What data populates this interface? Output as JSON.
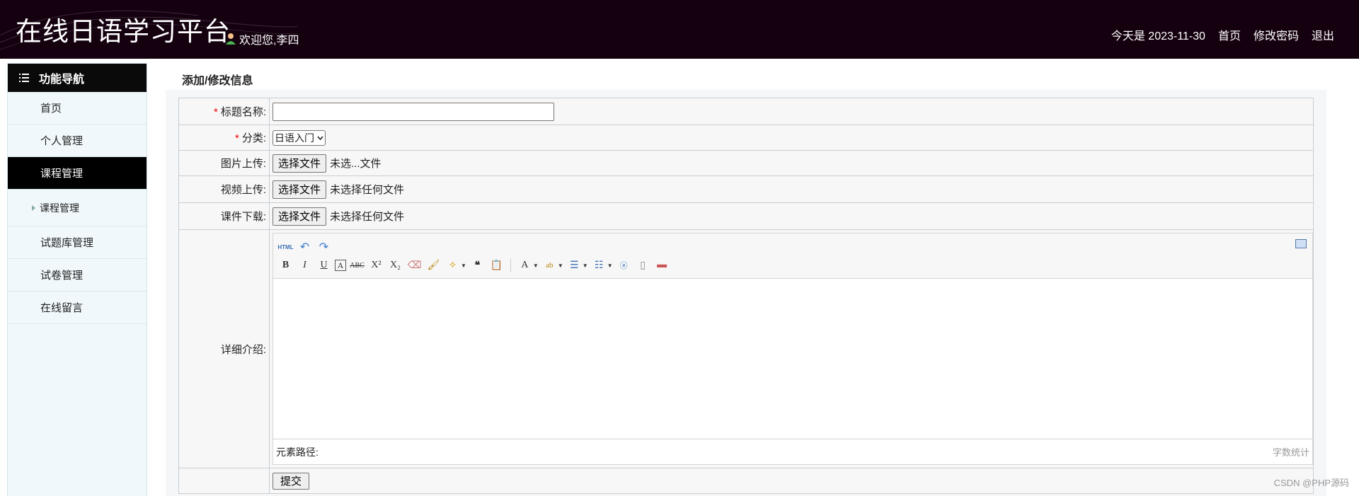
{
  "header": {
    "site_title": "在线日语学习平台",
    "welcome": "欢迎您,李四",
    "date_text": "今天是 2023-11-30",
    "links": [
      "首页",
      "修改密码",
      "退出"
    ]
  },
  "sidebar": {
    "title": "功能导航",
    "items": [
      {
        "label": "首页"
      },
      {
        "label": "个人管理"
      },
      {
        "label": "课程管理",
        "active": true
      },
      {
        "label": "课程管理",
        "sub": true
      },
      {
        "label": "试题库管理"
      },
      {
        "label": "试卷管理"
      },
      {
        "label": "在线留言"
      }
    ]
  },
  "main": {
    "page_title": "添加/修改信息",
    "fields": {
      "title_label": "标题名称:",
      "title_value": "",
      "category_label": "分类:",
      "category_value": "日语入门",
      "image_label": "图片上传:",
      "image_status": "未选...文件",
      "video_label": "视频上传:",
      "video_status": "未选择任何文件",
      "courseware_label": "课件下载:",
      "courseware_status": "未选择任何文件",
      "detail_label": "详细介绍:"
    },
    "choose_file_label": "选择文件",
    "editor": {
      "path_label": "元素路径:",
      "word_count": "字数统计",
      "html_label": "HTML"
    },
    "submit_label": "提交"
  },
  "watermark": "CSDN @PHP源码",
  "colors": {
    "header_bg": "#14000f",
    "sidebar_bg": "#f0f8fb",
    "active_item_bg": "#000000",
    "required_mark": "#ee0000"
  }
}
